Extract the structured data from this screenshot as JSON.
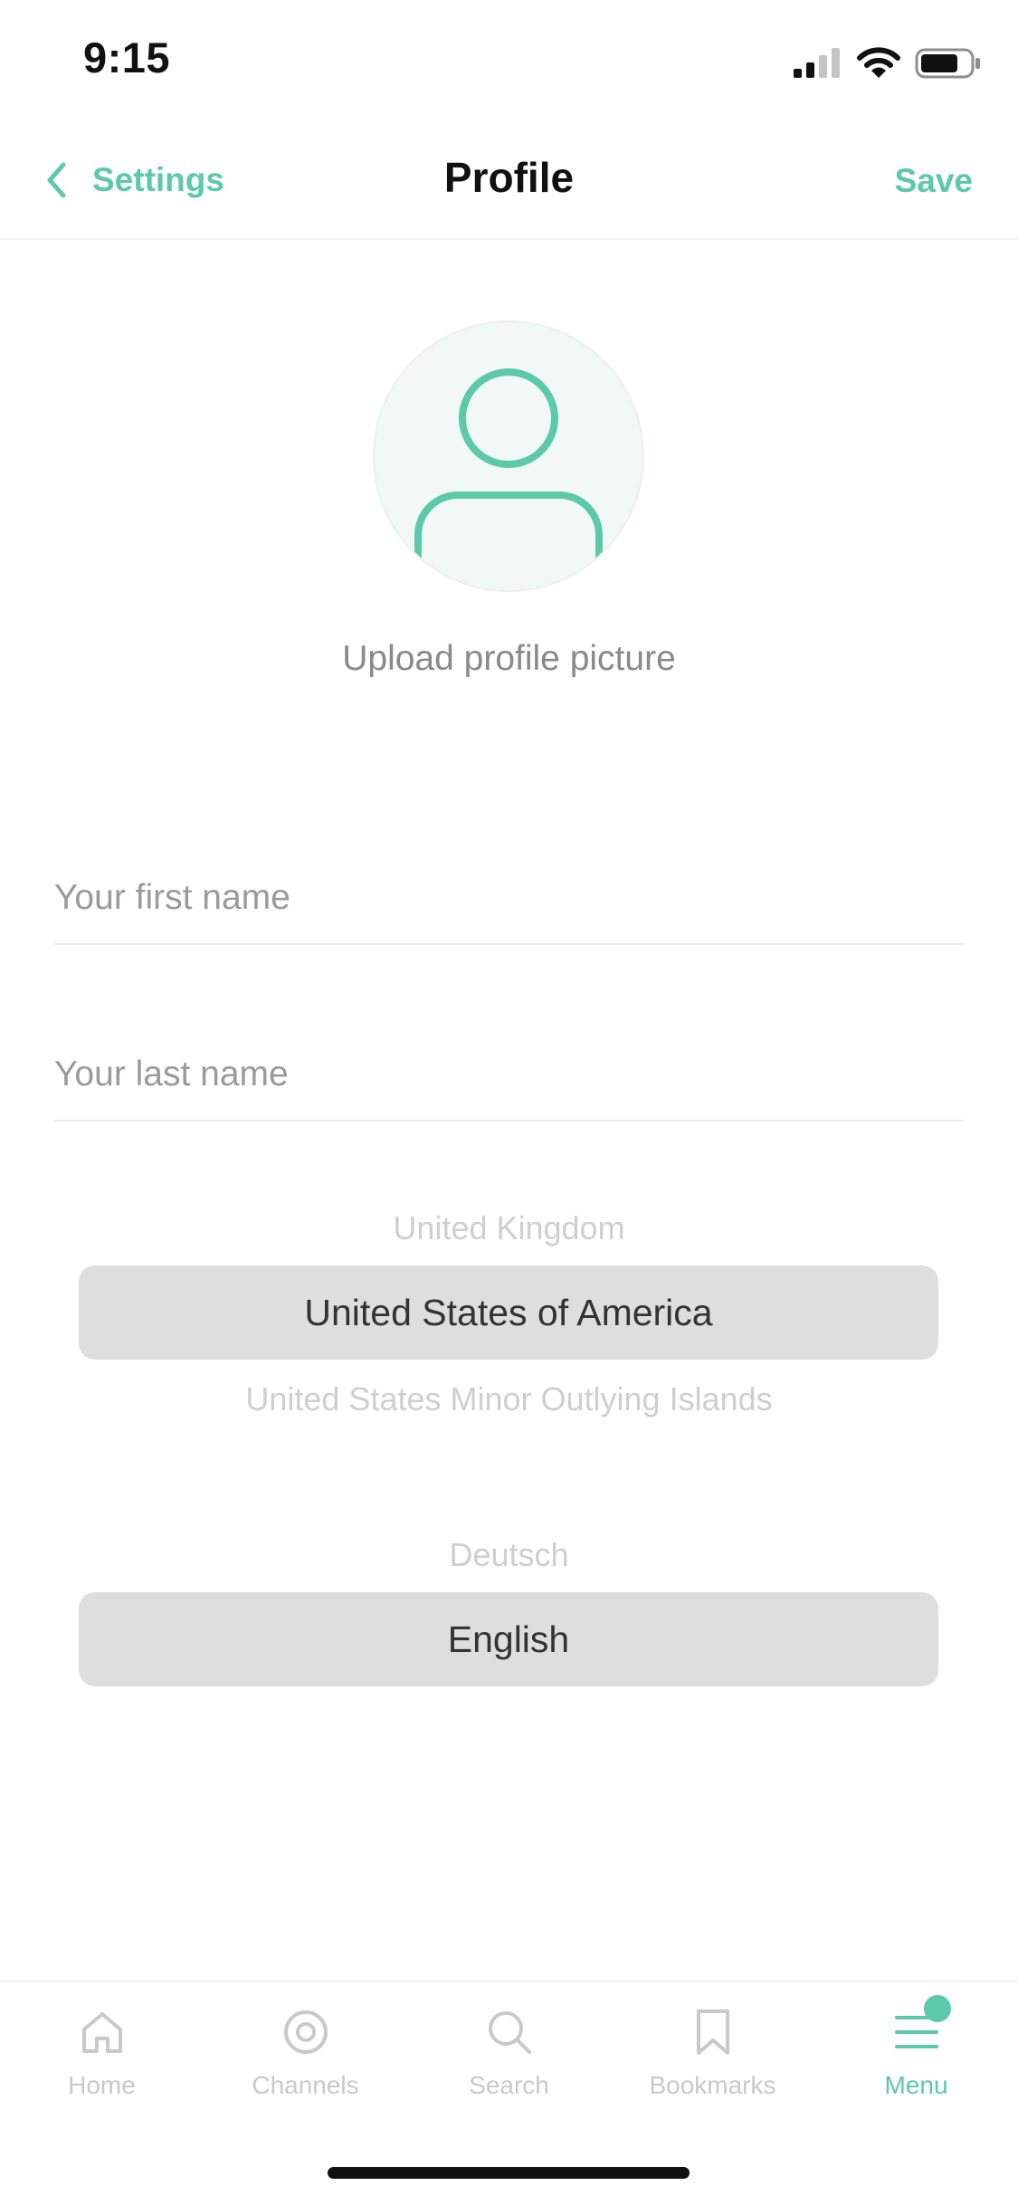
{
  "status_bar": {
    "time": "9:15"
  },
  "nav": {
    "back_label": "Settings",
    "title": "Profile",
    "save_label": "Save"
  },
  "profile": {
    "upload_label": "Upload profile picture",
    "first_name_placeholder": "Your first name",
    "first_name_value": "",
    "last_name_placeholder": "Your last name",
    "last_name_value": ""
  },
  "country_picker": {
    "option_above": "United Kingdom",
    "selected": "United States of America",
    "option_below": "United States Minor Outlying Islands"
  },
  "language_picker": {
    "option_above": "Deutsch",
    "selected": "English"
  },
  "tabs": [
    {
      "label": "Home",
      "icon": "home-icon",
      "active": false
    },
    {
      "label": "Channels",
      "icon": "channels-icon",
      "active": false
    },
    {
      "label": "Search",
      "icon": "search-icon",
      "active": false
    },
    {
      "label": "Bookmarks",
      "icon": "bookmark-icon",
      "active": false
    },
    {
      "label": "Menu",
      "icon": "menu-icon",
      "active": true
    }
  ],
  "colors": {
    "accent": "#5ccaa7",
    "inactive": "#c9c9c9",
    "picker_selection": "#dededf",
    "avatar_background": "#f1f8f5"
  }
}
